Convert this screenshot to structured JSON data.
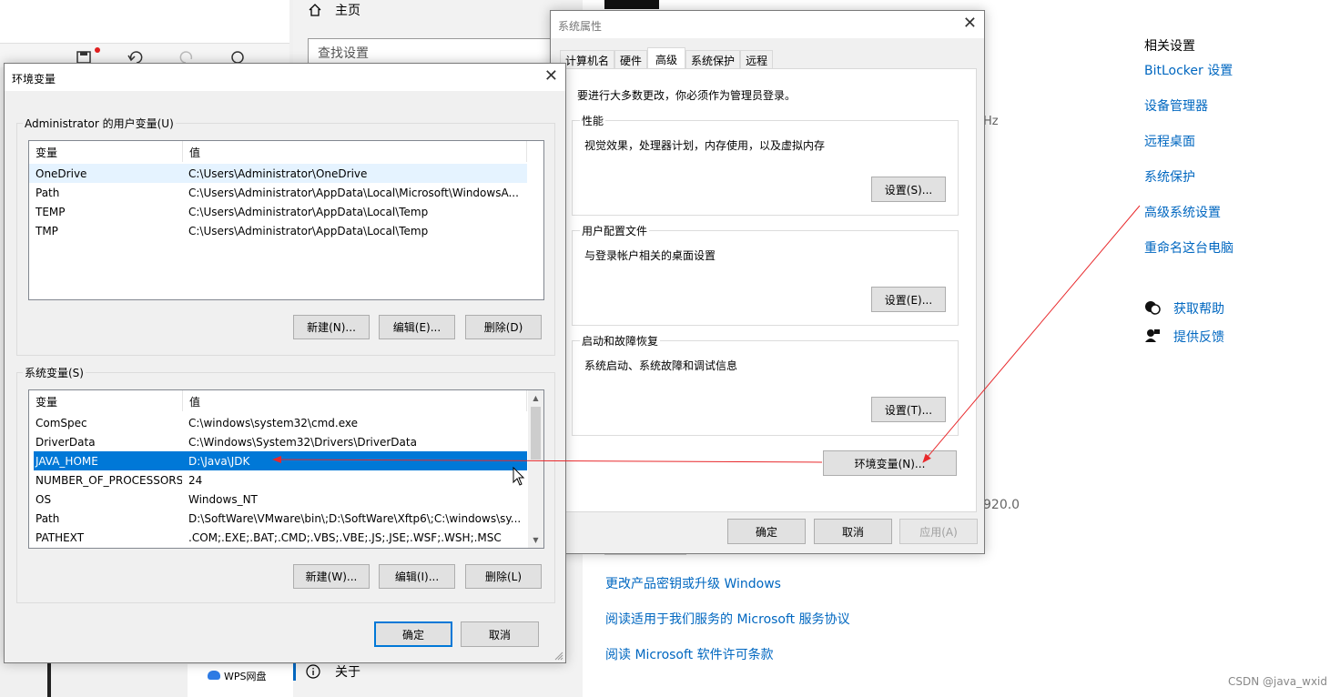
{
  "settings_nav": {
    "home_label": "主页",
    "search_placeholder": "查找设置",
    "about_label": "关于"
  },
  "background": {
    "wps_label": "WPS网盘",
    "hz_fragment": "Hz",
    "version_fragment": "920.0"
  },
  "related": {
    "title": "相关设置",
    "links": [
      "BitLocker 设置",
      "设备管理器",
      "远程桌面",
      "系统保护",
      "高级系统设置",
      "重命名这台电脑"
    ],
    "help": "获取帮助",
    "feedback": "提供反馈"
  },
  "bottom_links": [
    "更改产品密钥或升级 Windows",
    "阅读适用于我们服务的 Microsoft 服务协议",
    "阅读 Microsoft 软件许可条款"
  ],
  "sysprops": {
    "title": "系统属性",
    "tabs": [
      "计算机名",
      "硬件",
      "高级",
      "系统保护",
      "远程"
    ],
    "active_tab": "高级",
    "admin_note": "要进行大多数更改，你必须作为管理员登录。",
    "performance": {
      "caption": "性能",
      "desc": "视觉效果，处理器计划，内存使用，以及虚拟内存",
      "button": "设置(S)..."
    },
    "profiles": {
      "caption": "用户配置文件",
      "desc": "与登录帐户相关的桌面设置",
      "button": "设置(E)..."
    },
    "startup": {
      "caption": "启动和故障恢复",
      "desc": "系统启动、系统故障和调试信息",
      "button": "设置(T)..."
    },
    "env_button": "环境变量(N)...",
    "ok": "确定",
    "cancel": "取消",
    "apply": "应用(A)"
  },
  "envvars": {
    "title": "环境变量",
    "user_group": "Administrator 的用户变量(U)",
    "col_var": "变量",
    "col_val": "值",
    "user_vars": [
      {
        "name": "OneDrive",
        "value": "C:\\Users\\Administrator\\OneDrive"
      },
      {
        "name": "Path",
        "value": "C:\\Users\\Administrator\\AppData\\Local\\Microsoft\\WindowsA..."
      },
      {
        "name": "TEMP",
        "value": "C:\\Users\\Administrator\\AppData\\Local\\Temp"
      },
      {
        "name": "TMP",
        "value": "C:\\Users\\Administrator\\AppData\\Local\\Temp"
      }
    ],
    "user_buttons": [
      "新建(N)...",
      "编辑(E)...",
      "删除(D)"
    ],
    "sys_group": "系统变量(S)",
    "sys_vars": [
      {
        "name": "ComSpec",
        "value": "C:\\windows\\system32\\cmd.exe"
      },
      {
        "name": "DriverData",
        "value": "C:\\Windows\\System32\\Drivers\\DriverData"
      },
      {
        "name": "JAVA_HOME",
        "value": "D:\\Java\\JDK"
      },
      {
        "name": "NUMBER_OF_PROCESSORS",
        "value": "24"
      },
      {
        "name": "OS",
        "value": "Windows_NT"
      },
      {
        "name": "Path",
        "value": "D:\\SoftWare\\VMware\\bin\\;D:\\SoftWare\\Xftp6\\;C:\\windows\\sy..."
      },
      {
        "name": "PATHEXT",
        "value": ".COM;.EXE;.BAT;.CMD;.VBS;.VBE;.JS;.JSE;.WSF;.WSH;.MSC"
      }
    ],
    "selected_sys_var": "JAVA_HOME",
    "sys_buttons": [
      "新建(W)...",
      "编辑(I)...",
      "删除(L)"
    ],
    "ok": "确定",
    "cancel": "取消"
  },
  "annotation_color": "#e8282b",
  "watermark": "CSDN @java_wxid"
}
